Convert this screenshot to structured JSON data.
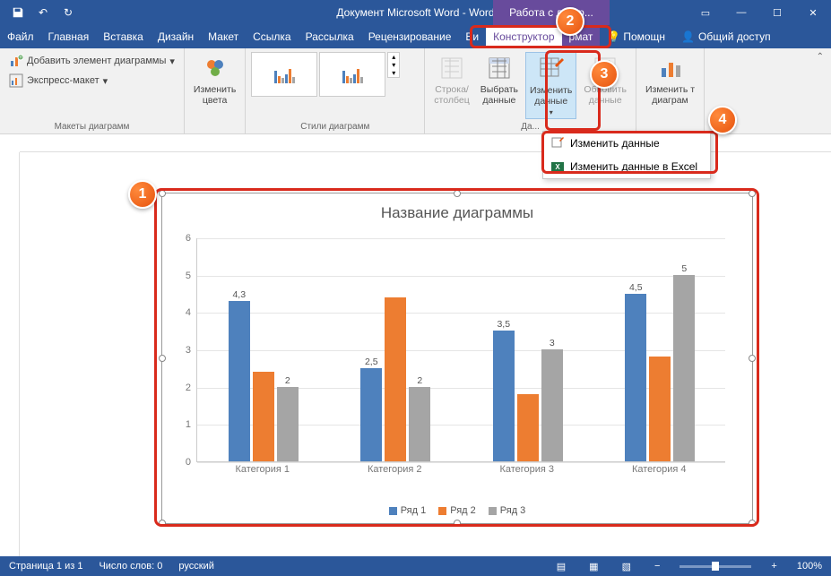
{
  "window": {
    "title": "Документ Microsoft Word - Word",
    "context_title": "Работа с диагр..."
  },
  "tabs": {
    "file": "Файл",
    "home": "Главная",
    "insert": "Вставка",
    "design": "Дизайн",
    "layout": "Макет",
    "references": "Ссылка",
    "mailings": "Рассылка",
    "review": "Рецензирование",
    "view": "Ви",
    "ctx_design": "Конструктор",
    "ctx_format": "рмат",
    "tell_me": "Помощн",
    "share": "Общий доступ"
  },
  "ribbon": {
    "add_element": "Добавить элемент диаграммы",
    "quick_layout": "Экспресс-макет",
    "group_layouts": "Макеты диаграмм",
    "change_colors": "Изменить\nцвета",
    "group_styles": "Стили диаграмм",
    "switch_rowcol": "Строка/\nстолбец",
    "select_data": "Выбрать\nданные",
    "edit_data": "Изменить\nданные",
    "refresh_data": "Обновить\nданные",
    "group_data": "Да...",
    "change_type": "Изменить т\nдиаграм",
    "collapse": "⌃"
  },
  "dropdown": {
    "edit_data": "Изменить данные",
    "edit_excel": "Изменить данные в Excel"
  },
  "chart_data": {
    "type": "bar",
    "title": "Название диаграммы",
    "categories": [
      "Категория 1",
      "Категория 2",
      "Категория 3",
      "Категория 4"
    ],
    "series": [
      {
        "name": "Ряд 1",
        "color": "#4e81bd",
        "values": [
          4.3,
          2.5,
          3.5,
          4.5
        ]
      },
      {
        "name": "Ряд 2",
        "color": "#ed7d31",
        "values": [
          2.4,
          4.4,
          1.8,
          2.8
        ]
      },
      {
        "name": "Ряд 3",
        "color": "#a5a5a5",
        "values": [
          2,
          2,
          3,
          5
        ]
      }
    ],
    "ylim": [
      0,
      6
    ],
    "ytick_step": 1,
    "data_labels": {
      "0": [
        "4,3",
        null,
        null,
        null
      ],
      "1": [
        "2,5",
        null,
        null,
        null
      ],
      "2": [
        "3,5",
        null,
        null,
        null
      ],
      "3": [
        "4,5",
        null,
        null,
        null
      ],
      "s2_0": "2",
      "s2_1": "2",
      "s2_2": "3",
      "s2_3": "5"
    }
  },
  "callouts": {
    "1": "1",
    "2": "2",
    "3": "3",
    "4": "4"
  },
  "statusbar": {
    "page": "Страница 1 из 1",
    "words": "Число слов: 0",
    "lang": "русский",
    "zoom": "100%",
    "zoom_minus": "−",
    "zoom_plus": "+"
  }
}
